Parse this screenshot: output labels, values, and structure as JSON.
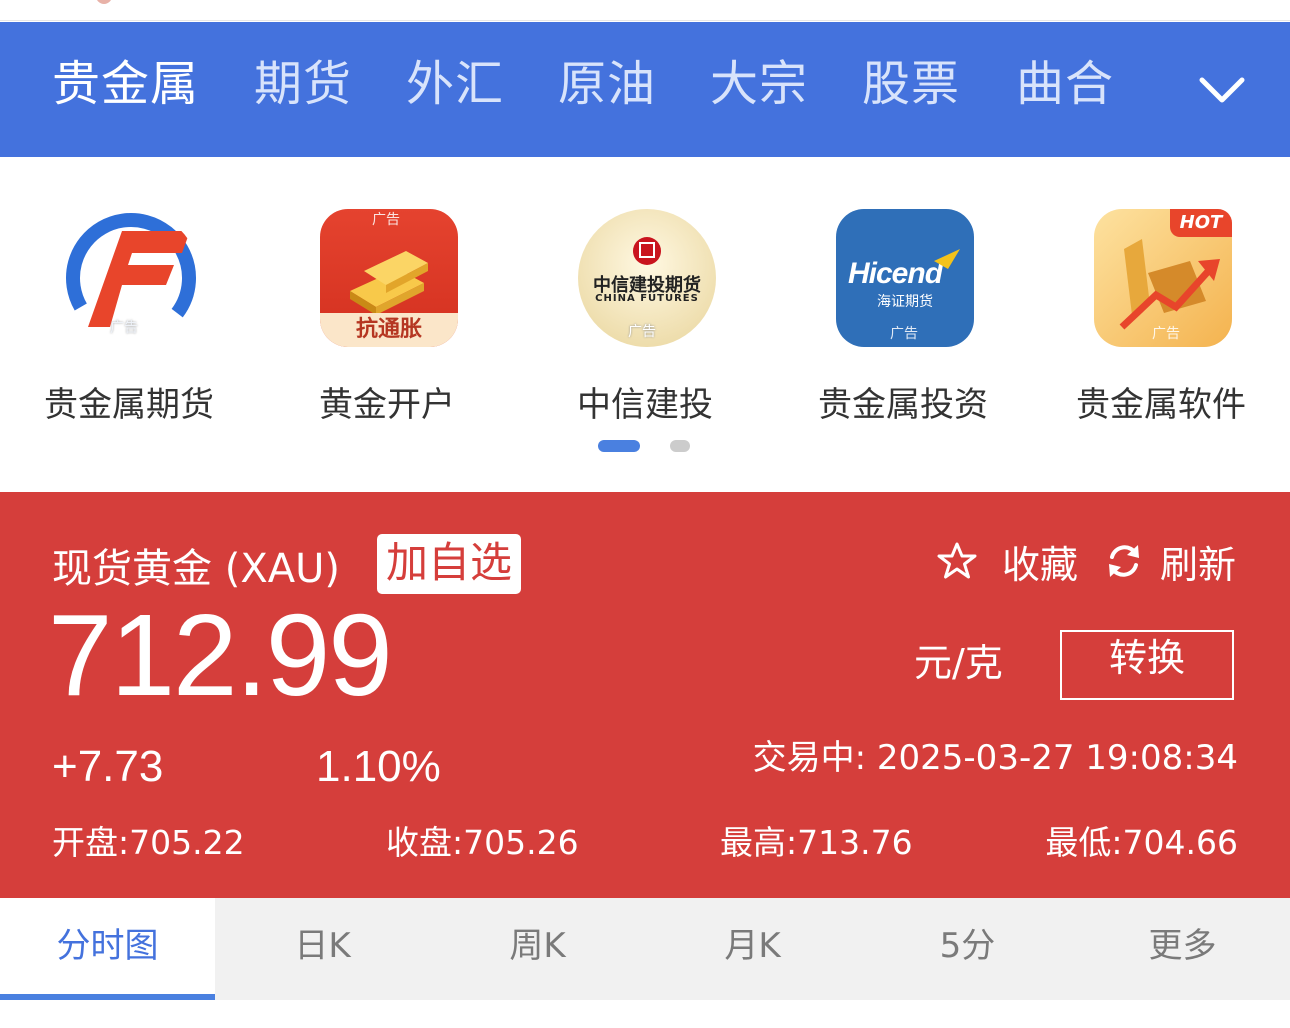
{
  "nav": {
    "tabs": [
      "贵金属",
      "期货",
      "外汇",
      "原油",
      "大宗",
      "股票",
      "曲合"
    ],
    "active_index": 0,
    "more_icon": "chevron-down-icon"
  },
  "ads": {
    "items": [
      {
        "label": "贵金属期货",
        "icon": "gf-futures-logo",
        "tag": "广告"
      },
      {
        "label": "黄金开户",
        "icon": "gold-bars-logo",
        "tag": "广告",
        "caption": "抗通胀"
      },
      {
        "label": "中信建投",
        "icon": "china-futures-logo",
        "tag": "广告",
        "logo_text": "中信建投期货",
        "logo_subtext": "CHINA FUTURES"
      },
      {
        "label": "贵金属投资",
        "icon": "hicend-logo",
        "tag": "广告",
        "logo_text": "Hicend",
        "logo_subtext": "海证期货"
      },
      {
        "label": "贵金属软件",
        "icon": "gold-trend-logo",
        "tag": "广告",
        "badge": "HOT"
      }
    ],
    "page_count": 2,
    "active_page": 0
  },
  "quote": {
    "name": "现货黄金 (XAU)",
    "add_watch": "加自选",
    "favorite": "收藏",
    "refresh": "刷新",
    "price": "712.99",
    "unit": "元/克",
    "convert": "转换",
    "change": "+7.73",
    "change_pct": "1.10%",
    "status": "交易中:  2025-03-27 19:08:34",
    "open": "开盘:705.22",
    "close": "收盘:705.26",
    "high": "最高:713.76",
    "low": "最低:704.66"
  },
  "chart_tabs": {
    "items": [
      "分时图",
      "日K",
      "周K",
      "月K",
      "5分",
      "更多"
    ],
    "active_index": 0
  },
  "colors": {
    "nav_bg": "#4472dd",
    "panel_bg": "#d53e3b",
    "accent_blue": "#4472dd"
  }
}
